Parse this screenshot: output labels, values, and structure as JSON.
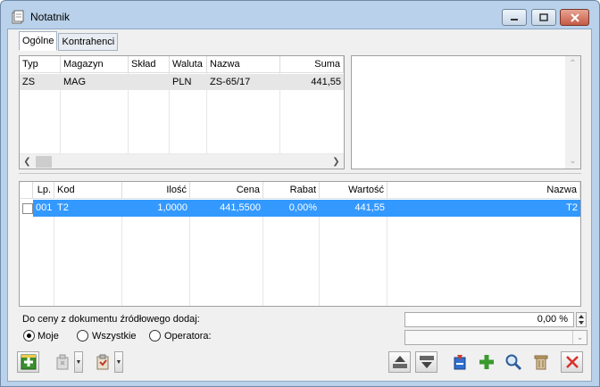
{
  "window": {
    "title": "Notatnik"
  },
  "tabs": [
    {
      "label": "Ogólne",
      "active": true
    },
    {
      "label": "Kontrahenci",
      "active": false
    }
  ],
  "documents_table": {
    "columns": [
      "Typ",
      "Magazyn",
      "Skład",
      "Waluta",
      "Nazwa",
      "Suma"
    ],
    "rows": [
      {
        "typ": "ZS",
        "magazyn": "MAG",
        "sklad": "",
        "waluta": "PLN",
        "nazwa": "ZS-65/17",
        "suma": "441,55"
      }
    ]
  },
  "items_table": {
    "columns": [
      "Lp.",
      "Kod",
      "Ilość",
      "Cena",
      "Rabat",
      "Wartość",
      "Nazwa"
    ],
    "rows": [
      {
        "lp": "001",
        "kod": "T2",
        "ilosc": "1,0000",
        "cena": "441,5500",
        "rabat": "0,00%",
        "wartosc": "441,55",
        "nazwa": "T2",
        "selected": true
      }
    ]
  },
  "price_adjust": {
    "label": "Do ceny z dokumentu źródłowego dodaj:",
    "value": "0,00 %",
    "options": [
      {
        "label": "Moje",
        "selected": true
      },
      {
        "label": "Wszystkie",
        "selected": false
      },
      {
        "label": "Operatora:",
        "selected": false
      }
    ],
    "operator_value": ""
  },
  "colors": {
    "selection": "#3399ff",
    "frame": "#b9d1ea",
    "close": "#c55a45"
  }
}
